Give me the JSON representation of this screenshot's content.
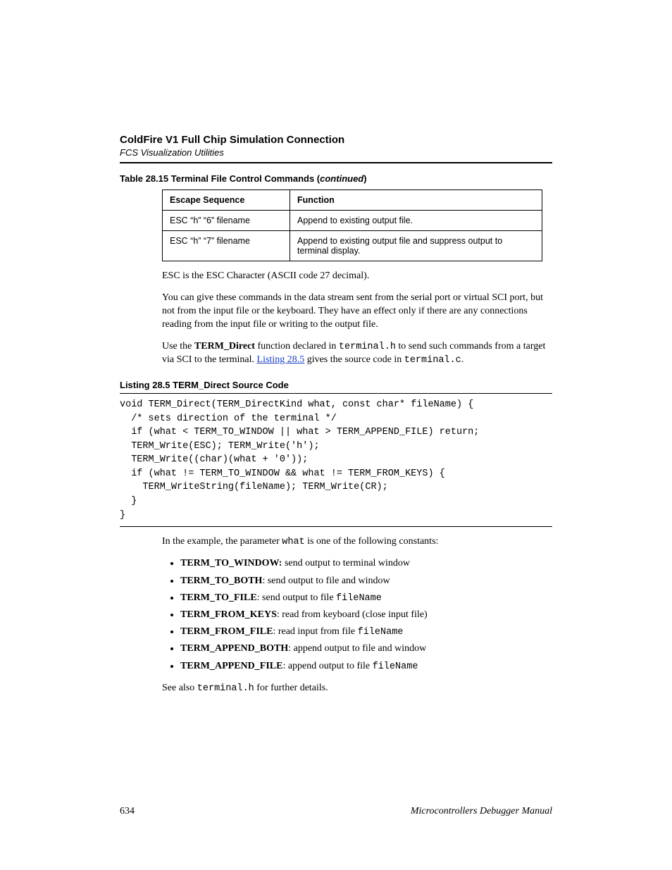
{
  "header": {
    "title": "ColdFire V1 Full Chip Simulation Connection",
    "subtitle": "FCS Visualization Utilities"
  },
  "table": {
    "caption_prefix": "Table 28.15  Terminal File Control Commands (",
    "caption_cont": "continued",
    "caption_suffix": ")",
    "col1": "Escape Sequence",
    "col2": "Function",
    "rows": [
      {
        "esc": "ESC “h” “6” filename",
        "fn": "Append to existing output file."
      },
      {
        "esc": "ESC “h” “7” filename",
        "fn": "Append to existing output file and suppress output to terminal display."
      }
    ]
  },
  "paras": {
    "p1": "ESC is the ESC Character (ASCII code 27 decimal).",
    "p2": "You can give these commands in the data stream sent from the serial port or virtual SCI port, but not from the input file or the keyboard. They have an effect only if there are any connections reading from the input file or writing to the output file.",
    "p3_a": "Use the ",
    "p3_b": "TERM_Direct",
    "p3_c": " function declared in ",
    "p3_code1": "terminal.h",
    "p3_d": " to send such commands from a target via SCI to the terminal. ",
    "p3_link": "Listing 28.5",
    "p3_e": " gives the source code in ",
    "p3_code2": "terminal.c",
    "p3_f": "."
  },
  "listing": {
    "caption": "Listing 28.5  TERM_Direct Source Code",
    "code": "void TERM_Direct(TERM_DirectKind what, const char* fileName) {\n  /* sets direction of the terminal */\n  if (what < TERM_TO_WINDOW || what > TERM_APPEND_FILE) return;\n  TERM_Write(ESC); TERM_Write('h');\n  TERM_Write((char)(what + '0'));\n  if (what != TERM_TO_WINDOW && what != TERM_FROM_KEYS) {\n    TERM_WriteString(fileName); TERM_Write(CR);\n  }\n}"
  },
  "example": {
    "intro_a": "In the example, the parameter ",
    "intro_code": "what",
    "intro_b": " is one of the following constants:",
    "items": [
      {
        "bold": "TERM_TO_WINDOW:",
        "rest": " send output to terminal window",
        "code": ""
      },
      {
        "bold": "TERM_TO_BOTH",
        "rest": ": send output to file and window",
        "code": ""
      },
      {
        "bold": "TERM_TO_FILE",
        "rest": ": send output to file ",
        "code": "fileName"
      },
      {
        "bold": "TERM_FROM_KEYS",
        "rest": ": read from keyboard (close input file)",
        "code": ""
      },
      {
        "bold": "TERM_FROM_FILE",
        "rest": ": read input from file ",
        "code": "fileName"
      },
      {
        "bold": "TERM_APPEND_BOTH",
        "rest": ": append output to file and window",
        "code": ""
      },
      {
        "bold": "TERM_APPEND_FILE",
        "rest": ": append output to file ",
        "code": "fileName"
      }
    ],
    "outro_a": "See also ",
    "outro_code": "terminal.h",
    "outro_b": " for further details."
  },
  "footer": {
    "page": "634",
    "manual": "Microcontrollers Debugger Manual"
  }
}
